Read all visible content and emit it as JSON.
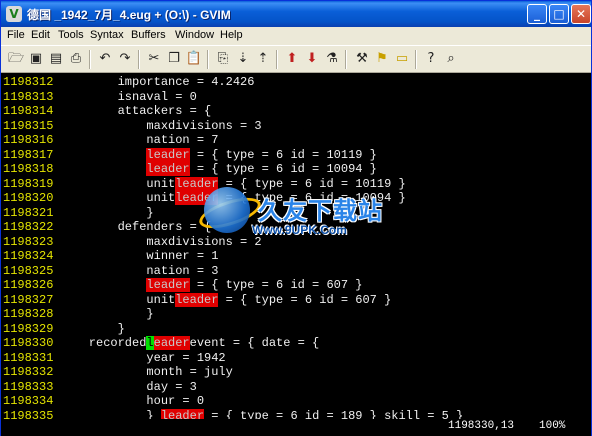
{
  "window": {
    "title": "德国 _1942_7月_4.eug + (O:\\) - GVIM",
    "app_icon": "gvim-icon",
    "controls": {
      "minimize": "_",
      "maximize": "□",
      "close": "✕"
    }
  },
  "menu": {
    "file": "File",
    "edit": "Edit",
    "tools": "Tools",
    "syntax": "Syntax",
    "buffers": "Buffers",
    "window": "Window",
    "help": "Help"
  },
  "toolbar": {
    "icons": [
      "open-icon",
      "save-icon",
      "save-all-icon",
      "print-icon",
      "undo-icon",
      "redo-icon",
      "cut-icon",
      "copy-icon",
      "paste-icon",
      "find-replace-icon",
      "find-next-icon",
      "find-prev-icon",
      "load-session-icon",
      "save-session-icon",
      "run-script-icon",
      "make-icon",
      "run-ctags-icon",
      "jump-tag-icon",
      "help-icon",
      "find-help-icon"
    ]
  },
  "editor": {
    "colors": {
      "background": "#000000",
      "line_number": "#e4e400",
      "text": "#f0f0f0",
      "search_highlight": "#e00000",
      "cursor": "#00e000"
    },
    "lines": [
      {
        "num": "1198312",
        "segs": [
          {
            "t": "        importance = 4.2426"
          }
        ]
      },
      {
        "num": "1198313",
        "segs": [
          {
            "t": "        isnaval = 0"
          }
        ]
      },
      {
        "num": "1198314",
        "segs": [
          {
            "t": "        attackers = {"
          }
        ]
      },
      {
        "num": "1198315",
        "segs": [
          {
            "t": "            maxdivisions = 3"
          }
        ]
      },
      {
        "num": "1198316",
        "segs": [
          {
            "t": "            nation = 7"
          }
        ]
      },
      {
        "num": "1198317",
        "segs": [
          {
            "t": "            "
          },
          {
            "t": "leader",
            "h": 1
          },
          {
            "t": " = { type = 6 id = 10119 }"
          }
        ]
      },
      {
        "num": "1198318",
        "segs": [
          {
            "t": "            "
          },
          {
            "t": "leader",
            "h": 1
          },
          {
            "t": " = { type = 6 id = 10094 }"
          }
        ]
      },
      {
        "num": "1198319",
        "segs": [
          {
            "t": "            unit"
          },
          {
            "t": "leader",
            "h": 1
          },
          {
            "t": " = { type = 6 id = 10119 }"
          }
        ]
      },
      {
        "num": "1198320",
        "segs": [
          {
            "t": "            unit"
          },
          {
            "t": "leader",
            "h": 1
          },
          {
            "t": " = { type = 6 id = 10094 }"
          }
        ]
      },
      {
        "num": "1198321",
        "segs": [
          {
            "t": "            }"
          }
        ]
      },
      {
        "num": "1198322",
        "segs": [
          {
            "t": "        defenders = {"
          }
        ]
      },
      {
        "num": "1198323",
        "segs": [
          {
            "t": "            maxdivisions = 2"
          }
        ]
      },
      {
        "num": "1198324",
        "segs": [
          {
            "t": "            winner = 1"
          }
        ]
      },
      {
        "num": "1198325",
        "segs": [
          {
            "t": "            nation = 3"
          }
        ]
      },
      {
        "num": "1198326",
        "segs": [
          {
            "t": "            "
          },
          {
            "t": "leader",
            "h": 1
          },
          {
            "t": " = { type = 6 id = 607 }"
          }
        ]
      },
      {
        "num": "1198327",
        "segs": [
          {
            "t": "            unit"
          },
          {
            "t": "leader",
            "h": 1
          },
          {
            "t": " = { type = 6 id = 607 }"
          }
        ]
      },
      {
        "num": "1198328",
        "segs": [
          {
            "t": "            }"
          }
        ]
      },
      {
        "num": "1198329",
        "segs": [
          {
            "t": "        }"
          }
        ]
      },
      {
        "num": "1198330",
        "segs": [
          {
            "t": "    recorded"
          },
          {
            "t": "l",
            "c": 1
          },
          {
            "t": "eader",
            "h": 1
          },
          {
            "t": "event = { date = {"
          }
        ]
      },
      {
        "num": "1198331",
        "segs": [
          {
            "t": "            year = 1942"
          }
        ]
      },
      {
        "num": "1198332",
        "segs": [
          {
            "t": "            month = july"
          }
        ]
      },
      {
        "num": "1198333",
        "segs": [
          {
            "t": "            day = 3"
          }
        ]
      },
      {
        "num": "1198334",
        "segs": [
          {
            "t": "            hour = 0"
          }
        ]
      },
      {
        "num": "1198335",
        "segs": [
          {
            "t": "            } "
          },
          {
            "t": "leader",
            "h": 1
          },
          {
            "t": " = { type = 6 id = 189 } skill = 5 }"
          }
        ]
      }
    ]
  },
  "status": {
    "position": "1198330,13",
    "percent": "100%"
  },
  "watermark": {
    "text": "久友下载站",
    "url": "Www.9UPK.Com"
  }
}
